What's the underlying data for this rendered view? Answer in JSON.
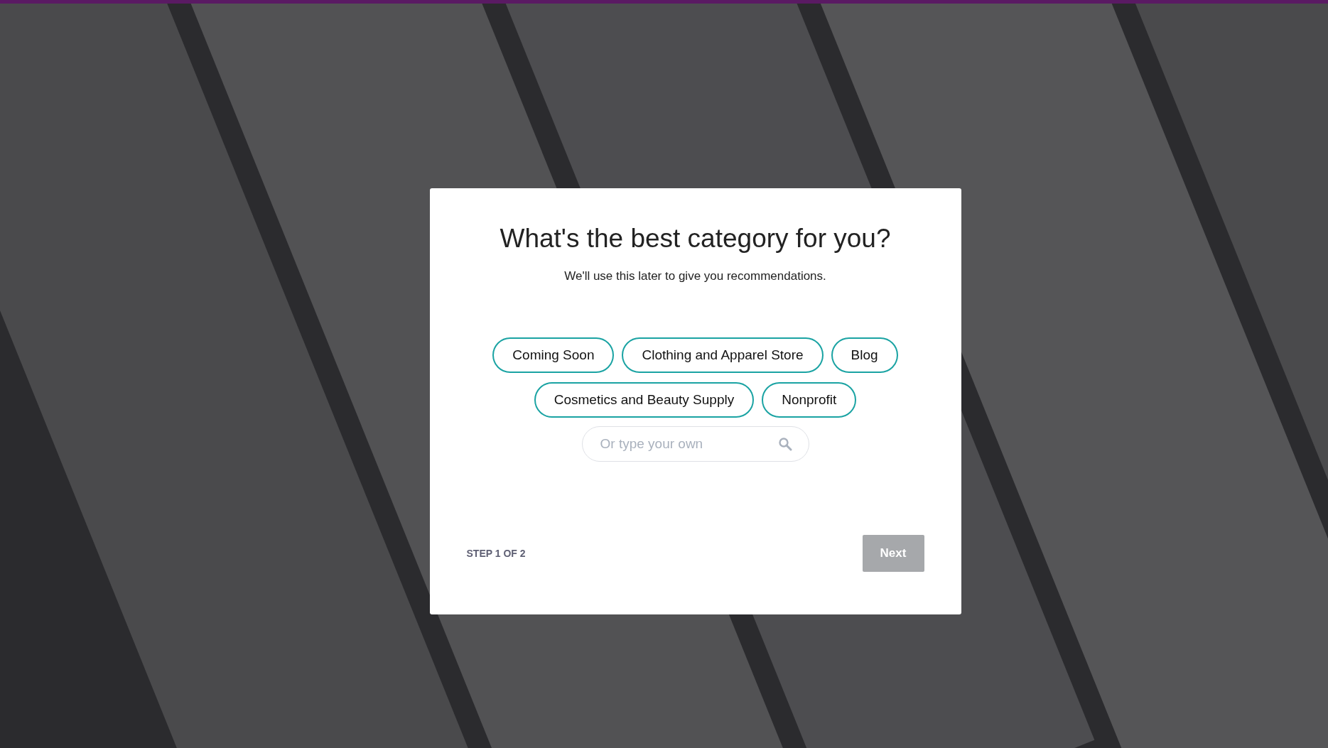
{
  "dialog": {
    "title": "What's the best category for you?",
    "subtitle": "We'll use this later to give you recommendations.",
    "categories": [
      {
        "label": "Coming Soon",
        "selected": false
      },
      {
        "label": "Clothing and Apparel Store",
        "selected": false
      },
      {
        "label": "Blog",
        "selected": false
      },
      {
        "label": "Cosmetics and Beauty Supply",
        "selected": false
      },
      {
        "label": "Nonprofit",
        "selected": false
      }
    ],
    "search": {
      "placeholder": "Or type your own"
    },
    "step": "STEP 1 OF 2",
    "next_button": {
      "label": "Next",
      "disabled": true
    }
  }
}
